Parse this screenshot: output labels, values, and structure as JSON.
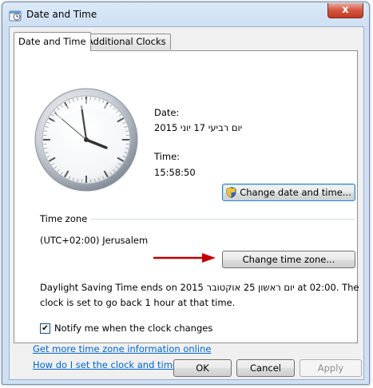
{
  "window": {
    "title": "Date and Time",
    "icon": "date-time-icon",
    "close_label": "x"
  },
  "tabs": [
    {
      "label": "Date and Time",
      "active": true
    },
    {
      "label": "Additional Clocks",
      "active": false
    }
  ],
  "datetime": {
    "date_label": "Date:",
    "date_value": "יום רביעי 17 יוני 2015",
    "time_label": "Time:",
    "time_value": "15:58:50",
    "change_button": "Change date and time..."
  },
  "timezone": {
    "heading": "Time zone",
    "value": "(UTC+02:00) Jerusalem",
    "change_button": "Change time zone..."
  },
  "dst": {
    "line1_prefix": "Daylight Saving Time ends on",
    "line1_date": "יום ראשון 25 אוקטובר 2015",
    "line1_suffix": "at 02:00. The",
    "line2": "clock is set to go back 1 hour at that time."
  },
  "notify": {
    "label": "Notify me when the clock changes",
    "checked": true
  },
  "links": {
    "more_info": "Get more time zone information online",
    "how_to": "How do I set the clock and time zone?"
  },
  "buttons": {
    "ok": "OK",
    "cancel": "Cancel",
    "apply": "Apply"
  },
  "colors": {
    "link": "#0066cc",
    "arrow": "#c00000",
    "close": "#c23a22"
  }
}
